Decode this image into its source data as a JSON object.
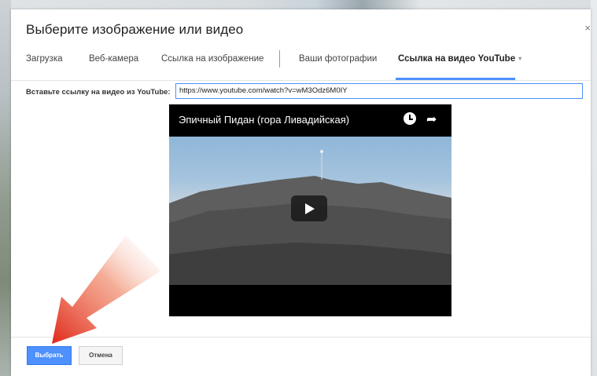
{
  "dialog": {
    "title": "Выберите изображение или видео",
    "close_glyph": "×"
  },
  "tabs": [
    {
      "label": "Загрузка",
      "active": false
    },
    {
      "label": "Веб-камера",
      "active": false
    },
    {
      "label": "Ссылка на изображение",
      "active": false
    },
    {
      "label": "Ваши фотографии",
      "active": false
    },
    {
      "label": "Ссылка на видео YouTube",
      "active": true
    }
  ],
  "tab_caret": "▾",
  "url_field": {
    "label": "Вставьте ссылку на видео из YouTube:",
    "value": "https://www.youtube.com/watch?v=wM3Odz6M0IY"
  },
  "video": {
    "title": "Эпичный Пидан (гора Ливадийская)",
    "icons": [
      "clock-icon",
      "share-icon",
      "play-icon"
    ]
  },
  "footer": {
    "select_label": "Выбрать",
    "cancel_label": "Отмена"
  },
  "colors": {
    "accent": "#4d90fe",
    "arrow": "#e23a22"
  }
}
